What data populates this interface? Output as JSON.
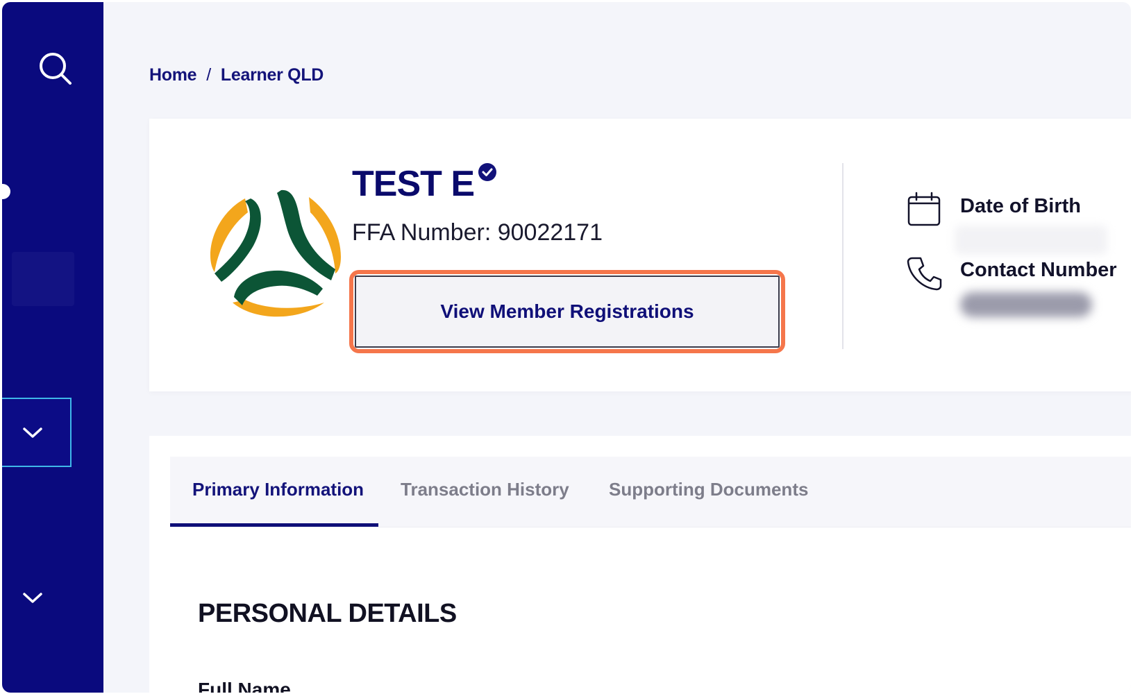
{
  "breadcrumb": {
    "home": "Home",
    "separator": "/",
    "current": "Learner QLD"
  },
  "profile": {
    "name": "TEST E",
    "ffa_number": "FFA Number: 90022171",
    "view_registrations_button": "View Member Registrations",
    "date_of_birth_label": "Date of Birth",
    "contact_number_label": "Contact Number"
  },
  "tabs": [
    {
      "label": "Primary Information",
      "active": true
    },
    {
      "label": "Transaction History",
      "active": false
    },
    {
      "label": "Supporting Documents",
      "active": false
    }
  ],
  "personal_details": {
    "title": "PERSONAL DETAILS",
    "full_name_label": "Full Name"
  },
  "icons": {
    "sidebar_search": "search-icon",
    "verified": "verified-badge-icon",
    "date_of_birth": "calendar-icon",
    "contact_number": "phone-icon",
    "chevron": "chevron-down-icon"
  },
  "colors": {
    "sidebar": "#0a0a7e",
    "brand_navy": "#13137a",
    "highlight": "#f5764b",
    "logo_green": "#0c5536",
    "logo_gold": "#f3a61c"
  }
}
